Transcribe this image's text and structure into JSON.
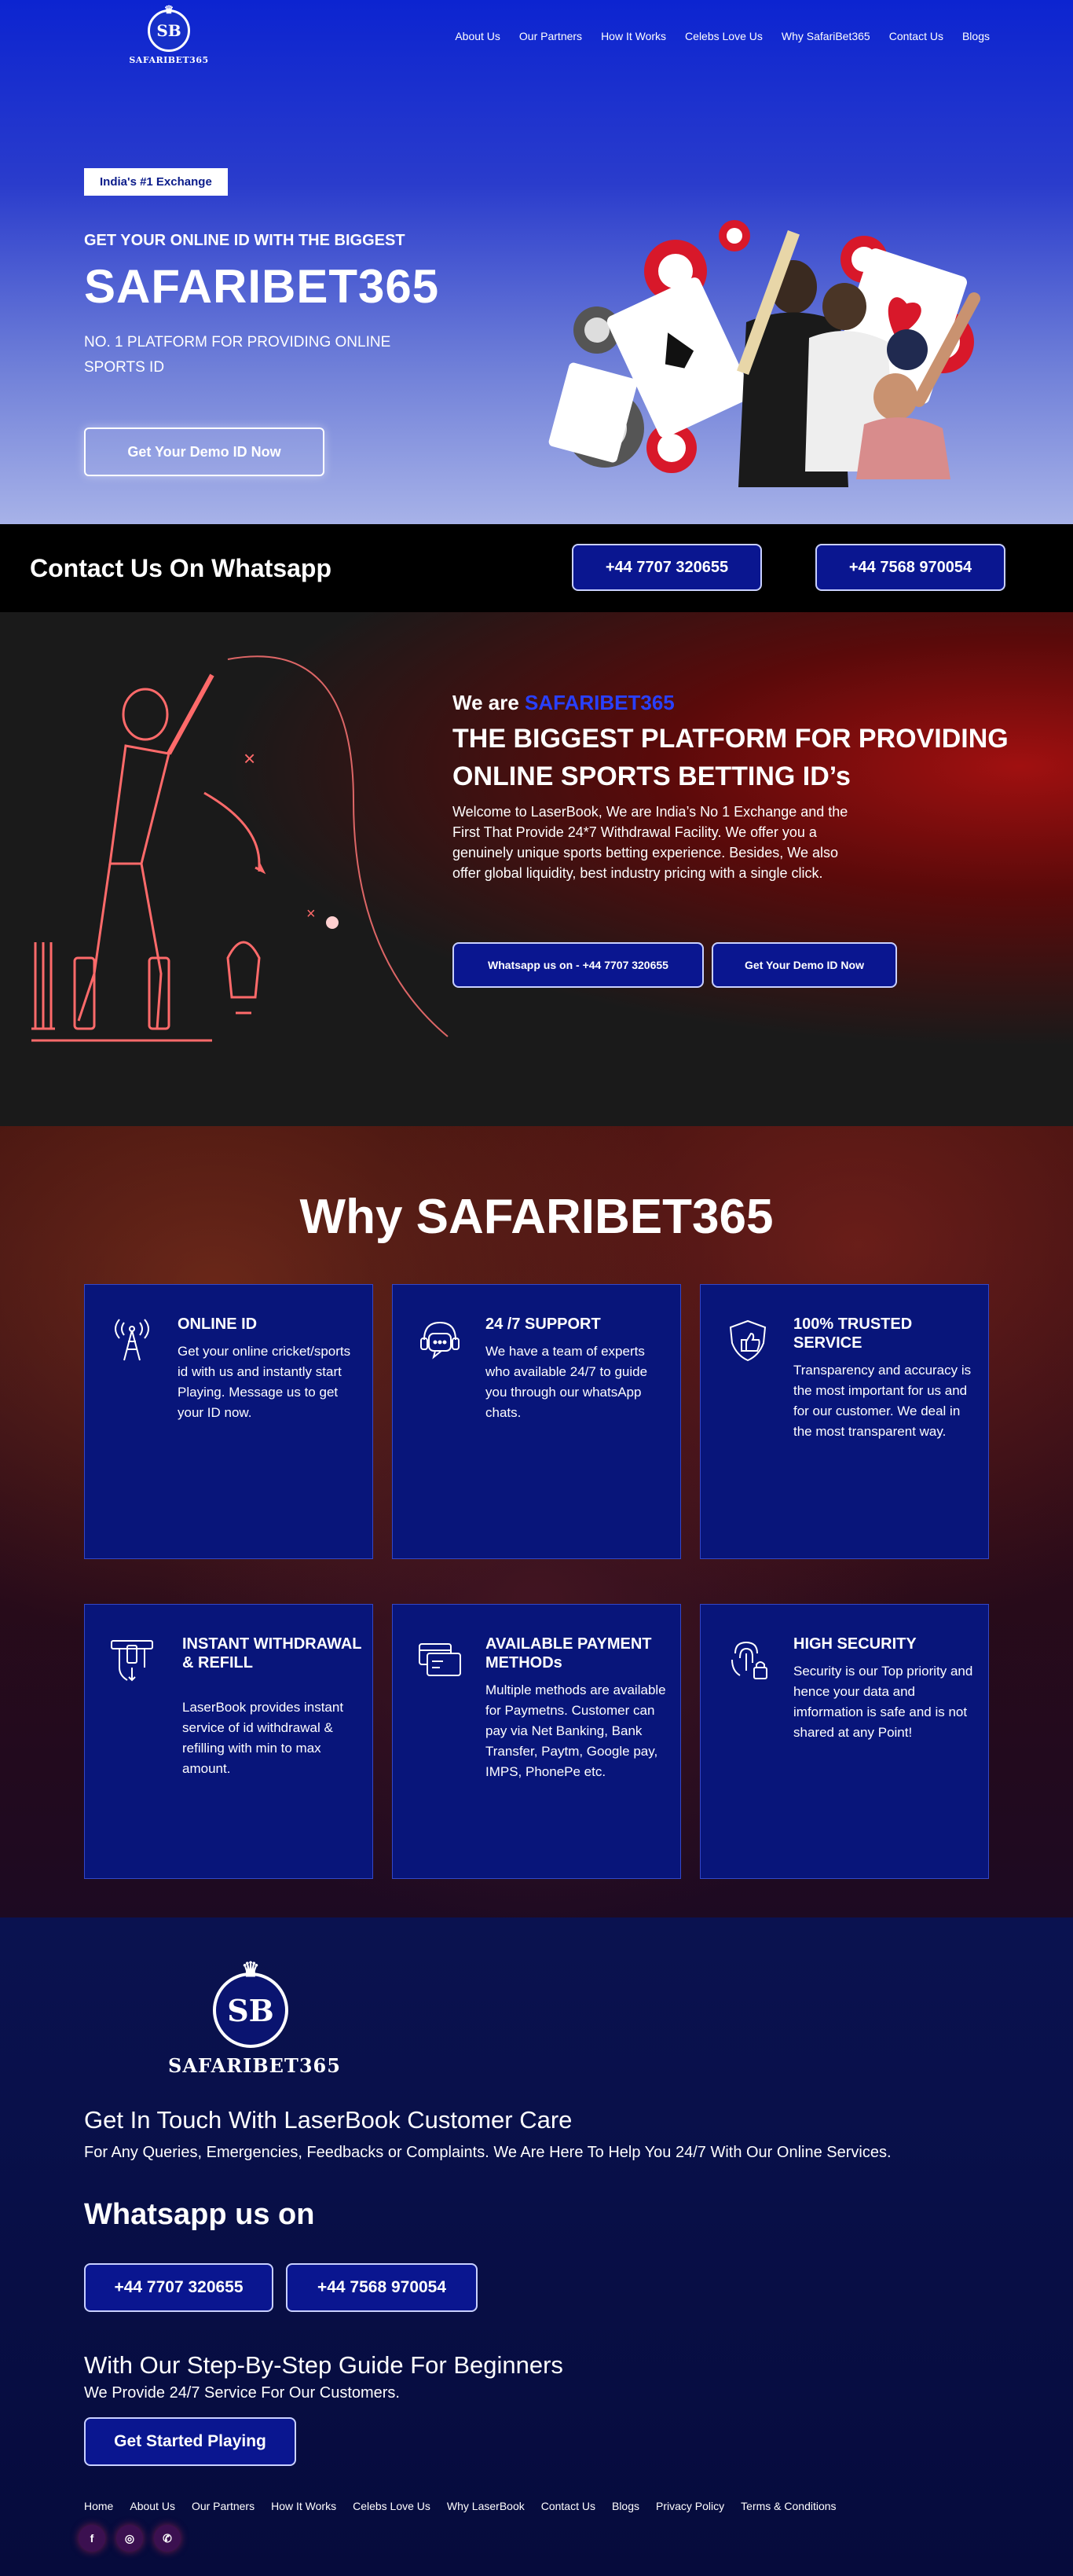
{
  "brand": {
    "logo_initials": "SB",
    "logo_text": "SAFARIBET365"
  },
  "nav": {
    "items": [
      "About Us",
      "Our Partners",
      "How It Works",
      "Celebs Love Us",
      "Why SafariBet365",
      "Contact Us",
      "Blogs"
    ]
  },
  "hero": {
    "badge": "India's #1 Exchange",
    "subtitle": "GET YOUR ONLINE ID WITH THE BIGGEST",
    "title": "SAFARIBET365",
    "description": "NO. 1 PLATFORM FOR PROVIDING ONLINE SPORTS ID",
    "cta": "Get Your Demo ID Now"
  },
  "contact_strip": {
    "title": "Contact Us On Whatsapp",
    "phone1": "+44 7707 320655",
    "phone2": "+44 7568 970054"
  },
  "about": {
    "we_are": "We are",
    "brand": "SAFARIBET365",
    "title": "THE BIGGEST PLATFORM FOR PROVIDING ONLINE SPORTS BETTING ID’s",
    "description": "Welcome to LaserBook, We are India’s No 1 Exchange and the First That Provide 24*7 Withdrawal Facility. We offer you a genuinely unique sports betting experience. Besides, We also offer global liquidity, best industry pricing with a single click.",
    "btn_whatsapp": "Whatsapp us on - +44 7707 320655",
    "btn_demo": "Get Your Demo ID Now"
  },
  "why": {
    "title": "Why SAFARIBET365",
    "cards": [
      {
        "icon": "antenna-icon",
        "title": "ONLINE ID",
        "body": "Get your online cricket/sports id with us and instantly start Playing. Message us to get your ID now."
      },
      {
        "icon": "support-headset-icon",
        "title": "24 /7 SUPPORT",
        "body": "We have a team of experts who available 24/7 to guide you through our whatsApp chats."
      },
      {
        "icon": "shield-thumb-icon",
        "title": "100% TRUSTED SERVICE",
        "body": "Transparency and accuracy is the most important for us and for our customer. We deal in the most transparent way."
      },
      {
        "icon": "withdrawal-icon",
        "title": "INSTANT WITHDRAWAL & REFILL",
        "body": "LaserBook provides instant service of id withdrawal & refilling with min to max amount."
      },
      {
        "icon": "payment-cards-icon",
        "title": "AVAILABLE PAYMENT METHODs",
        "body": "Multiple methods are available for Paymetns. Customer can pay via Net Banking, Bank Transfer, Paytm, Google pay, IMPS, PhonePe etc."
      },
      {
        "icon": "fingerprint-lock-icon",
        "title": "HIGH SECURITY",
        "body": "Security is our Top priority and hence your data and imformation is safe and is not shared at any Point!"
      }
    ]
  },
  "footer": {
    "heading1": "Get In Touch With LaserBook Customer Care",
    "text1": "For Any Queries, Emergencies, Feedbacks or Complaints. We Are Here To Help You 24/7 With Our Online Services.",
    "heading2": "Whatsapp us on",
    "phone1": "+44 7707 320655",
    "phone2": "+44 7568 970054",
    "heading3": "With Our Step-By-Step Guide For Beginners",
    "text2": "We Provide 24/7 Service For Our Customers.",
    "cta": "Get Started Playing",
    "links": [
      "Home",
      "About Us",
      "Our Partners",
      "How It Works",
      "Celebs Love Us",
      "Why LaserBook",
      "Contact Us",
      "Blogs",
      "Privacy Policy",
      "Terms & Conditions"
    ],
    "socials": [
      {
        "icon": "facebook-icon",
        "glyph": "f"
      },
      {
        "icon": "instagram-icon",
        "glyph": "◎"
      },
      {
        "icon": "whatsapp-icon",
        "glyph": "✆"
      }
    ]
  },
  "colors": {
    "primary": "#0a1690",
    "accent": "#2940ff",
    "hero_top": "#0c24d0",
    "footer_bg": "#060b3c"
  }
}
